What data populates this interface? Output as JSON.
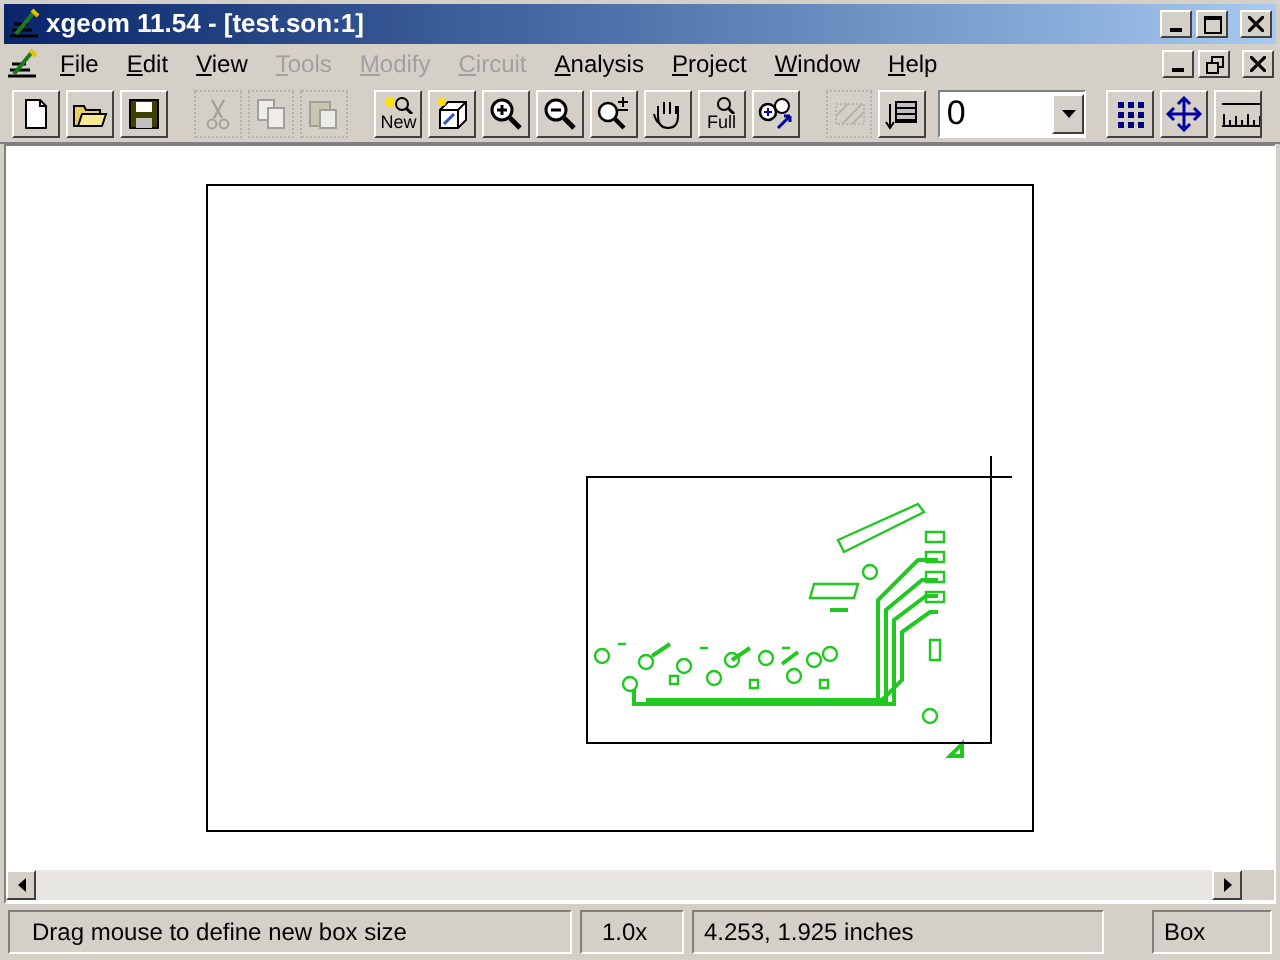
{
  "window": {
    "title": "xgeom 11.54 - [test.son:1]"
  },
  "menu": [
    {
      "label": "File",
      "disabled": false
    },
    {
      "label": "Edit",
      "disabled": false
    },
    {
      "label": "View",
      "disabled": false
    },
    {
      "label": "Tools",
      "disabled": true
    },
    {
      "label": "Modify",
      "disabled": true
    },
    {
      "label": "Circuit",
      "disabled": true
    },
    {
      "label": "Analysis",
      "disabled": false
    },
    {
      "label": "Project",
      "disabled": false
    },
    {
      "label": "Window",
      "disabled": false
    },
    {
      "label": "Help",
      "disabled": false
    }
  ],
  "toolbar": [
    {
      "kind": "new-file",
      "disabled": false
    },
    {
      "kind": "open",
      "disabled": false
    },
    {
      "kind": "save",
      "disabled": false
    },
    {
      "kind": "separator"
    },
    {
      "kind": "cut",
      "disabled": true
    },
    {
      "kind": "copy",
      "disabled": true
    },
    {
      "kind": "paste",
      "disabled": true
    },
    {
      "kind": "separator"
    },
    {
      "kind": "new-view",
      "label": "New",
      "disabled": false
    },
    {
      "kind": "box3d",
      "disabled": false
    },
    {
      "kind": "zoom-in",
      "disabled": false
    },
    {
      "kind": "zoom-out",
      "disabled": false
    },
    {
      "kind": "zoom-step",
      "disabled": false
    },
    {
      "kind": "pan",
      "disabled": false
    },
    {
      "kind": "zoom-full",
      "label": "Full",
      "disabled": false
    },
    {
      "kind": "zoom-move",
      "disabled": false
    },
    {
      "kind": "separator"
    },
    {
      "kind": "hatch",
      "disabled": true
    },
    {
      "kind": "layers",
      "disabled": false
    },
    {
      "kind": "dropdown",
      "value": "0"
    },
    {
      "kind": "separator"
    },
    {
      "kind": "grid",
      "disabled": false
    },
    {
      "kind": "move",
      "disabled": false
    },
    {
      "kind": "ruler",
      "disabled": false
    }
  ],
  "status_bar": {
    "message": "Drag mouse to define new box size",
    "zoom": "1.0x",
    "coordinates": "4.253, 1.925 inches",
    "mode": "Box"
  }
}
